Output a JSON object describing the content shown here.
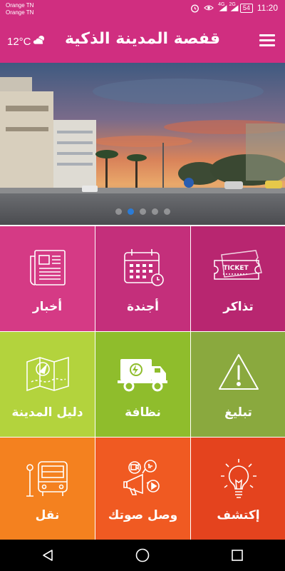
{
  "status_bar": {
    "carrier_1": "Orange TN",
    "carrier_2": "Orange TN",
    "network_1": "4G",
    "network_2": "2G",
    "battery": "54",
    "time": "11:20"
  },
  "app_bar": {
    "title": "قفصة المدينة الذكية",
    "temperature": "12°C"
  },
  "banner": {
    "slide_count": 5,
    "active_index": 1
  },
  "tiles": [
    {
      "label": "أخبار",
      "icon": "newspaper-icon",
      "color": "#d53a85"
    },
    {
      "label": "أجندة",
      "icon": "calendar-icon",
      "color": "#c42f7b"
    },
    {
      "label": "تذاكر",
      "icon": "ticket-icon",
      "color": "#b82670"
    },
    {
      "label": "دليل المدينة",
      "icon": "map-icon",
      "color": "#b3d33d"
    },
    {
      "label": "نظافة",
      "icon": "garbage-truck-icon",
      "color": "#8fbd2c"
    },
    {
      "label": "تبليغ",
      "icon": "warning-icon",
      "color": "#8aa93e"
    },
    {
      "label": "نقل",
      "icon": "bus-icon",
      "color": "#f4811f"
    },
    {
      "label": "وصل صوتك",
      "icon": "megaphone-icon",
      "color": "#f05a22"
    },
    {
      "label": "إكتشف",
      "icon": "lightbulb-icon",
      "color": "#e4431e"
    }
  ],
  "ticket_text": "TICKET",
  "colors": {
    "primary": "#d02e80",
    "dot_active": "#2b7bd6"
  }
}
